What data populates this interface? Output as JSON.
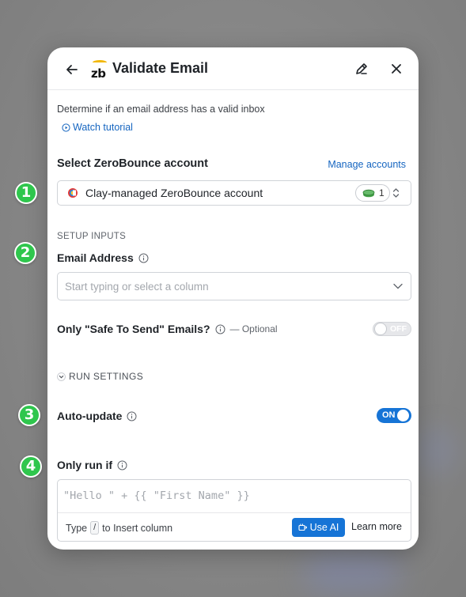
{
  "modal": {
    "title": "Validate Email",
    "logo_text": "zb",
    "description": "Determine if an email address has a valid inbox",
    "watch_tutorial": "Watch tutorial"
  },
  "account": {
    "section_label": "Select ZeroBounce account",
    "manage_link": "Manage accounts",
    "selected": "Clay-managed ZeroBounce account",
    "credits": "1"
  },
  "inputs": {
    "section_label": "SETUP INPUTS",
    "email_label": "Email Address",
    "email_placeholder": "Start typing or select a column",
    "safe_label": "Only \"Safe To Send\" Emails?",
    "safe_optional": "— Optional",
    "safe_toggle": "OFF"
  },
  "run_settings": {
    "label": "RUN SETTINGS",
    "auto_update_label": "Auto-update",
    "auto_update_toggle": "ON",
    "only_run_if_label": "Only run if",
    "formula_placeholder": "\"Hello \" + {{ \"First Name\" }}",
    "hint_prefix": "Type",
    "hint_key": "/",
    "hint_suffix": "to Insert column",
    "use_ai": "Use AI",
    "learn_more": "Learn more"
  },
  "steps": [
    "1",
    "2",
    "3",
    "4"
  ],
  "colors": {
    "accent": "#1674d6",
    "step_badge": "#2fc64d",
    "link": "#1565c0"
  }
}
